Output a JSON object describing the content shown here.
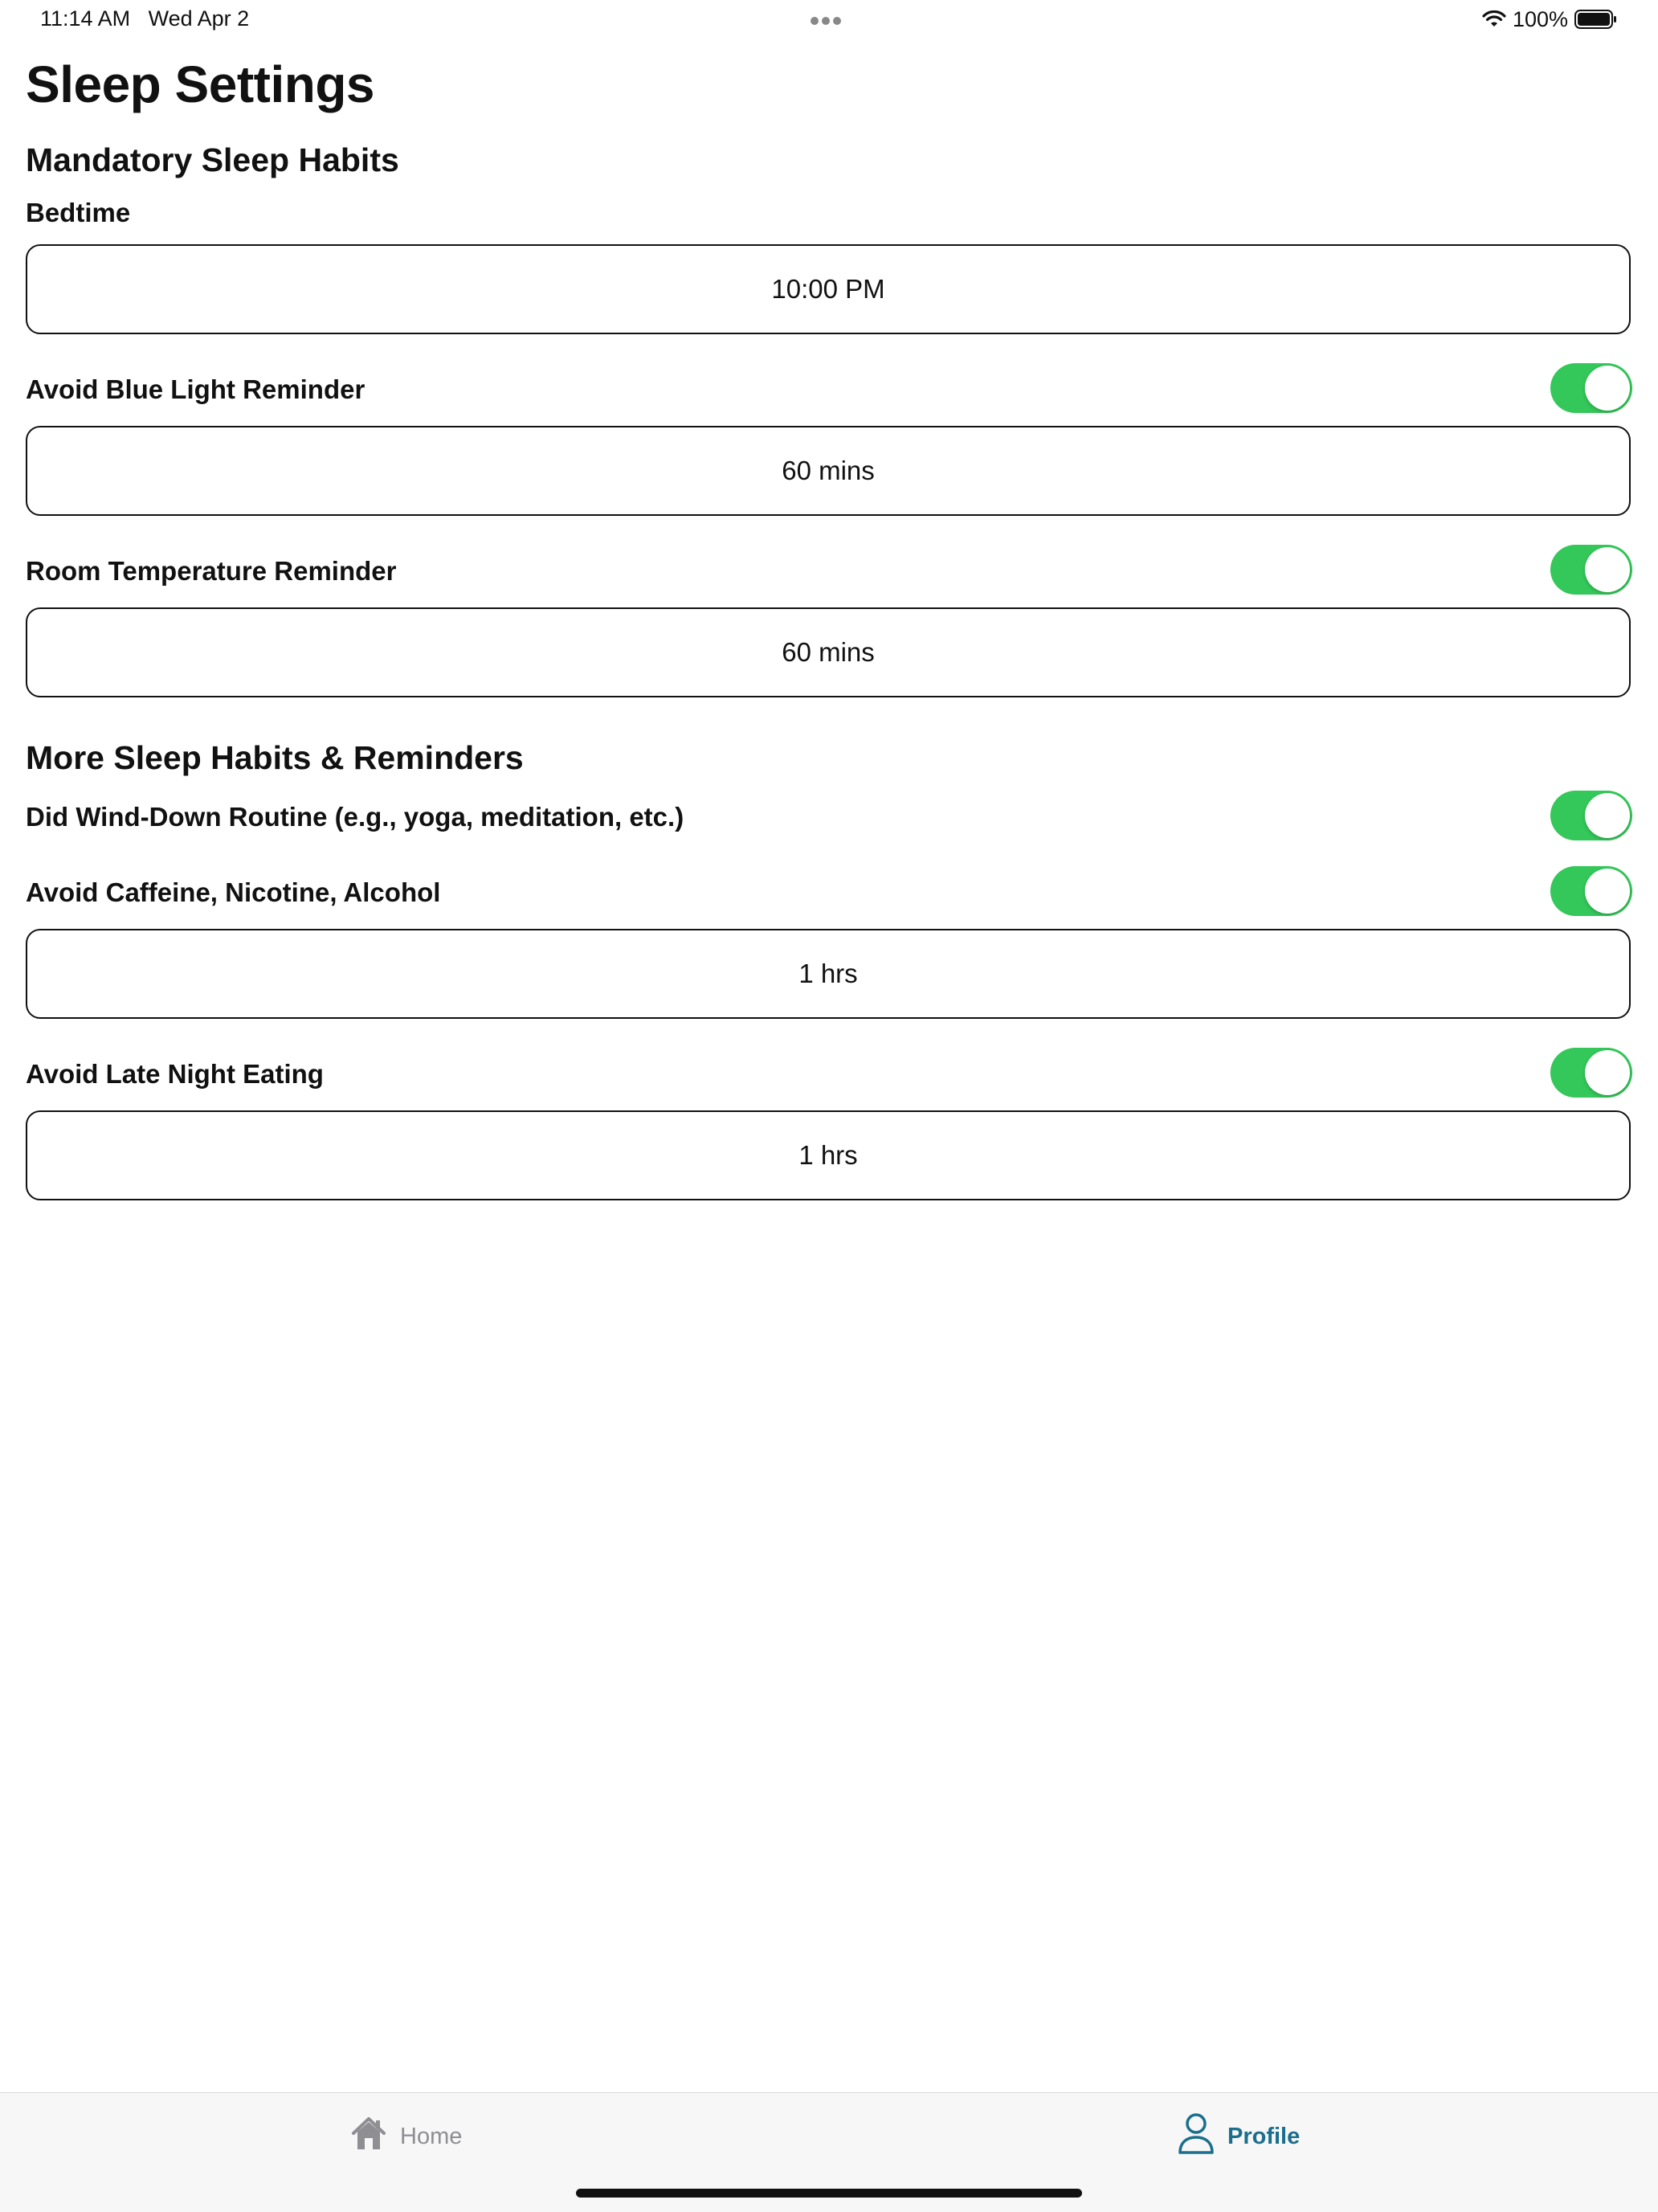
{
  "status_bar": {
    "time": "11:14 AM",
    "date": "Wed Apr 2",
    "battery": "100%"
  },
  "page": {
    "title": "Sleep Settings"
  },
  "mandatory": {
    "title": "Mandatory Sleep Habits",
    "bedtime": {
      "label": "Bedtime",
      "value": "10:00 PM"
    },
    "blue_light": {
      "label": "Avoid Blue Light Reminder",
      "enabled": true,
      "value": "60 mins"
    },
    "room_temp": {
      "label": "Room Temperature Reminder",
      "enabled": true,
      "value": "60 mins"
    }
  },
  "more": {
    "title": "More Sleep Habits & Reminders",
    "wind_down": {
      "label": "Did Wind-Down Routine (e.g., yoga, meditation, etc.)",
      "enabled": true
    },
    "caffeine": {
      "label": "Avoid Caffeine, Nicotine, Alcohol",
      "enabled": true,
      "value": "1 hrs"
    },
    "late_eating": {
      "label": "Avoid Late Night Eating",
      "enabled": true,
      "value": "1 hrs"
    }
  },
  "tab_bar": {
    "home": {
      "label": "Home",
      "icon": "house-icon"
    },
    "profile": {
      "label": "Profile",
      "icon": "person-icon",
      "selected": true
    }
  },
  "colors": {
    "toggle_on": "#34c759",
    "tab_active": "#1b6f8c",
    "tab_inactive": "#8e8e93"
  }
}
